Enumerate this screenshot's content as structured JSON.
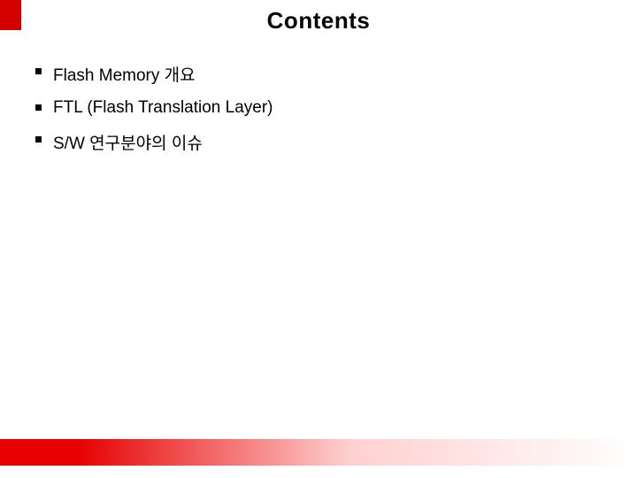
{
  "title": "Contents",
  "items": [
    "Flash Memory 개요",
    "FTL (Flash Translation Layer)",
    "S/W 연구분야의 이슈"
  ]
}
